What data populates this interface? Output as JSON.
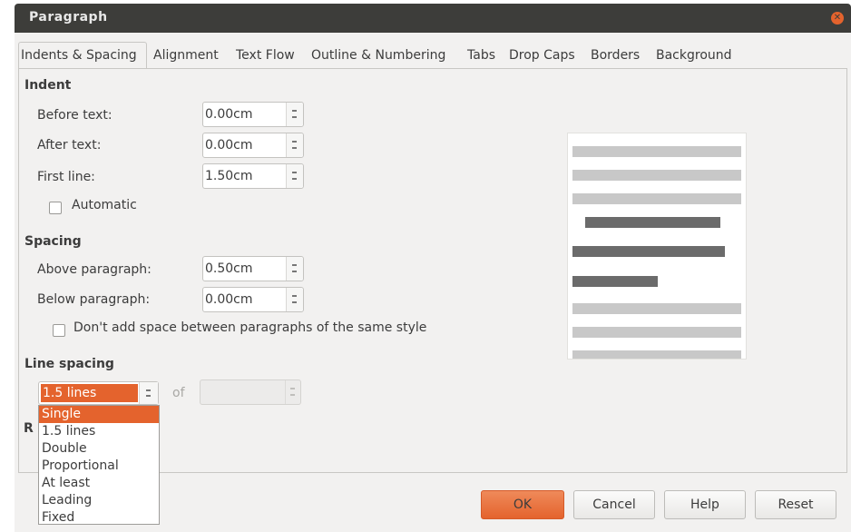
{
  "window": {
    "title": "Paragraph",
    "close_icon": "close-icon"
  },
  "tabs": [
    {
      "label": "Indents & Spacing",
      "active": true
    },
    {
      "label": "Alignment"
    },
    {
      "label": "Text Flow"
    },
    {
      "label": "Outline & Numbering"
    },
    {
      "label": "Tabs"
    },
    {
      "label": "Drop Caps"
    },
    {
      "label": "Borders"
    },
    {
      "label": "Background"
    }
  ],
  "indent": {
    "heading": "Indent",
    "before_label": "Before text:",
    "before_value": "0.00cm",
    "after_label": "After text:",
    "after_value": "0.00cm",
    "first_label": "First line:",
    "first_value": "1.50cm",
    "automatic_label": "Automatic",
    "automatic_checked": false
  },
  "spacing": {
    "heading": "Spacing",
    "above_label": "Above paragraph:",
    "above_value": "0.50cm",
    "below_label": "Below paragraph:",
    "below_value": "0.00cm",
    "dont_add_label": "Don't add space between paragraphs of the same style",
    "dont_add_checked": false
  },
  "line_spacing": {
    "heading": "Line spacing",
    "selected": "1.5 lines",
    "of_label": "of",
    "of_value": "",
    "options": [
      "Single",
      "1.5 lines",
      "Double",
      "Proportional",
      "At least",
      "Leading",
      "Fixed"
    ],
    "highlighted_option": "Single",
    "partially_hidden_label": "R"
  },
  "buttons": {
    "ok": "OK",
    "cancel": "Cancel",
    "help": "Help",
    "reset": "Reset"
  },
  "colors": {
    "accent": "#e4632d",
    "titlebar": "#3d3d3a",
    "dialog_bg": "#f2f1f0"
  }
}
